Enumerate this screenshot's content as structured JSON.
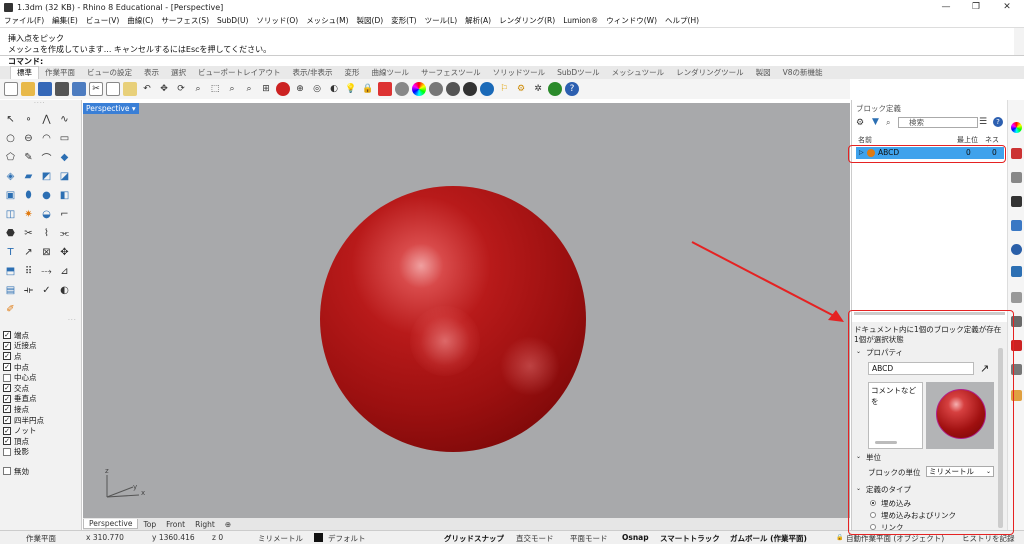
{
  "window": {
    "title": "1.3dm (32 KB) - Rhino 8 Educational - [Perspective]",
    "controls": [
      "—",
      "❐",
      "✕"
    ]
  },
  "menu": [
    "ファイル(F)",
    "編集(E)",
    "ビュー(V)",
    "曲線(C)",
    "サーフェス(S)",
    "SubD(U)",
    "ソリッド(O)",
    "メッシュ(M)",
    "製図(D)",
    "変形(T)",
    "ツール(L)",
    "解析(A)",
    "レンダリング(R)",
    "Lumion®",
    "ウィンドウ(W)",
    "ヘルプ(H)"
  ],
  "command": {
    "line1": "挿入点をピック",
    "line2": "メッシュを作成しています... キャンセルするにはEscを押してください。",
    "prompt_label": "コマンド:"
  },
  "toolbar_tabs": [
    "標準",
    "作業平面",
    "ビューの設定",
    "表示",
    "選択",
    "ビューポートレイアウト",
    "表示/非表示",
    "変形",
    "曲線ツール",
    "サーフェスツール",
    "ソリッドツール",
    "SubDツール",
    "メッシュツール",
    "レンダリングツール",
    "製図",
    "V8の新機能"
  ],
  "osnap": [
    {
      "label": "端点",
      "checked": true
    },
    {
      "label": "近接点",
      "checked": true
    },
    {
      "label": "点",
      "checked": true
    },
    {
      "label": "中点",
      "checked": true
    },
    {
      "label": "中心点",
      "checked": false
    },
    {
      "label": "交点",
      "checked": true
    },
    {
      "label": "垂直点",
      "checked": true
    },
    {
      "label": "接点",
      "checked": true
    },
    {
      "label": "四半円点",
      "checked": true
    },
    {
      "label": "ノット",
      "checked": true
    },
    {
      "label": "頂点",
      "checked": true
    },
    {
      "label": "投影",
      "checked": false
    },
    {
      "label": "無効",
      "checked": false
    }
  ],
  "viewport": {
    "label": "Perspective",
    "axis_x": "x",
    "axis_y": "y",
    "axis_z": "z",
    "tabs": [
      "Perspective",
      "Top",
      "Front",
      "Right",
      "⊕"
    ]
  },
  "block_panel": {
    "title": "ブロック定義",
    "search_placeholder": "検索",
    "columns": {
      "name": "名前",
      "toplevel": "最上位",
      "nest": "ネスト"
    },
    "row": {
      "name": "ABCD",
      "toplevel": "0",
      "nest": "0"
    },
    "info_line1": "ドキュメント内に1個のブロック定義が存在",
    "info_line2": "1個が選択状態",
    "section_properties": "プロパティ",
    "name_value": "ABCD",
    "comment_placeholder": "コメントなどを",
    "section_units": "単位",
    "units_label": "ブロックの単位",
    "units_value": "ミリメートル",
    "section_type": "定義のタイプ",
    "type_options": [
      {
        "label": "埋め込み",
        "selected": true
      },
      {
        "label": "埋め込みおよびリンク",
        "selected": false
      },
      {
        "label": "リンク",
        "selected": false
      }
    ]
  },
  "statusbar": {
    "cplane": "作業平面",
    "x": "x 310.770",
    "y": "y 1360.416",
    "z": "z 0",
    "units": "ミリメートル",
    "layer": "デフォルト",
    "gridsnap": "グリッドスナップ",
    "ortho": "直交モード",
    "planar": "平面モード",
    "osnap": "Osnap",
    "smarttrack": "スマートトラック",
    "gumball": "ガムボール (作業平面)",
    "autocplane": "自動作業平面 (オブジェクト)",
    "history": "ヒストリを記録"
  },
  "colors": {
    "accent_blue": "#3fa2ec",
    "annotation_red": "#e52222",
    "sphere_red": "#b81a1a"
  }
}
